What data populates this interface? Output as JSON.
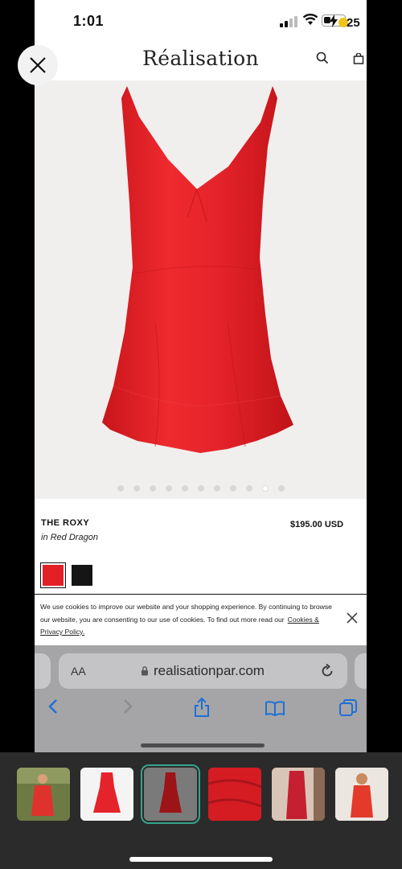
{
  "status_bar": {
    "time": "1:01",
    "battery": "25"
  },
  "site": {
    "brand": "Réalisation"
  },
  "product": {
    "name": "THE ROXY",
    "variant": "in Red Dragon",
    "price": "$195.00 USD",
    "swatches": [
      "red",
      "black"
    ],
    "dress_color": "#e32026"
  },
  "carousel": {
    "total": 11,
    "active_index": 9
  },
  "cookie": {
    "text": "We use cookies to improve our website and your shopping experience. By continuing to browse our website, you are consenting to our use of cookies. To find out more read our",
    "link": "Cookies & Privacy Policy."
  },
  "browser": {
    "aa_label": "AA",
    "url": "realisationpar.com"
  },
  "icons": [
    "close-icon",
    "search-icon",
    "bag-icon",
    "lock-icon",
    "reload-icon",
    "back-icon",
    "forward-icon",
    "share-icon",
    "bookmarks-icon",
    "tabs-icon"
  ],
  "gallery": {
    "thumbnail_count": 6,
    "selected_index": 2
  }
}
